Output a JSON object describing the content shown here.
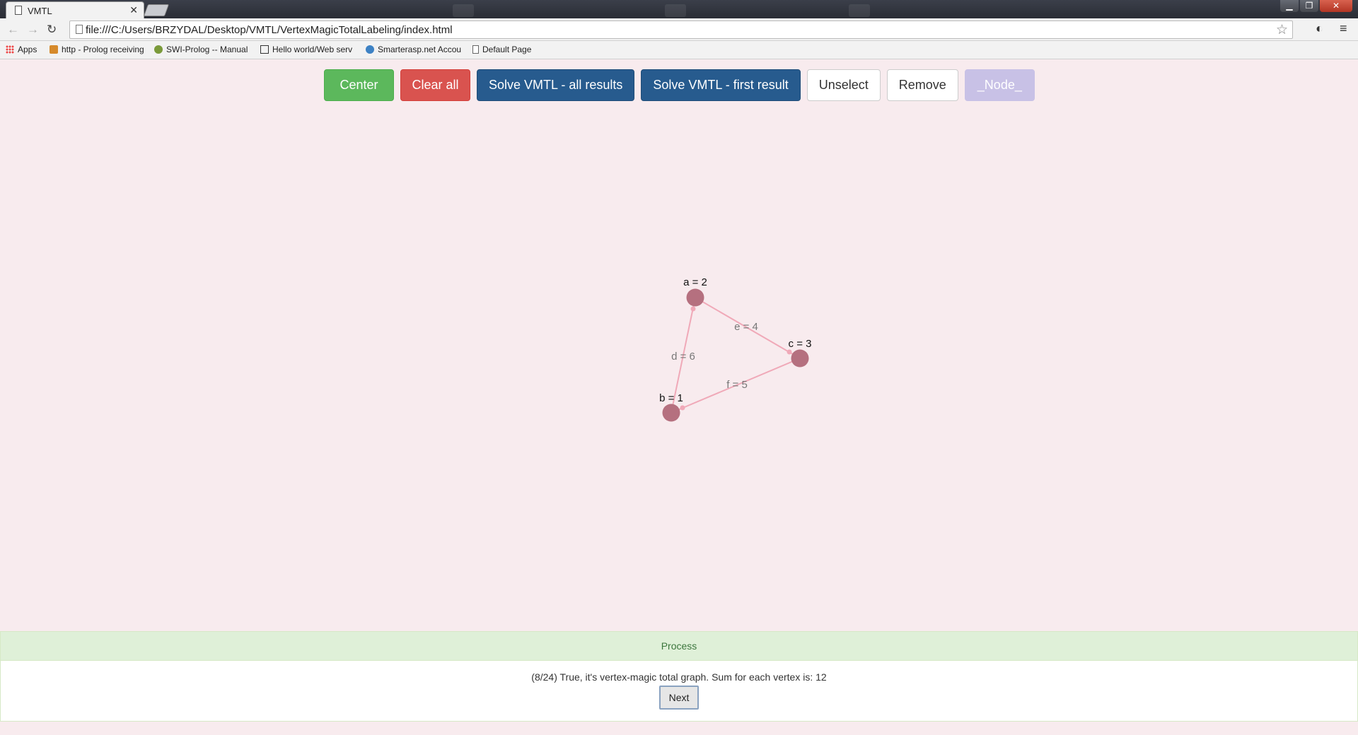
{
  "browser": {
    "tab_title": "VMTL",
    "tab_close": "✕",
    "window_controls": {
      "minimize": "▁",
      "maximize": "❐",
      "close": "✕"
    },
    "nav": {
      "back": "←",
      "forward": "→",
      "reload": "↻",
      "star": "☆",
      "extension": "◐",
      "menu": "≡"
    },
    "url": "file:///C:/Users/BRZYDAL/Desktop/VMTL/VertexMagicTotalLabeling/index.html",
    "bookmarks": [
      {
        "label": "Apps",
        "icon": "apps-grid-icon"
      },
      {
        "label": "http - Prolog receiving",
        "icon": "prolog-icon"
      },
      {
        "label": "SWI-Prolog -- Manual",
        "icon": "swi-prolog-icon"
      },
      {
        "label": "Hello world/Web serv",
        "icon": "rosetta-code-icon"
      },
      {
        "label": "Smarterasp.net Accou",
        "icon": "smarterasp-icon"
      },
      {
        "label": "Default Page",
        "icon": "page-icon"
      }
    ]
  },
  "toolbar": {
    "center": "Center",
    "clear_all": "Clear all",
    "solve_all": "Solve VMTL - all results",
    "solve_first": "Solve VMTL - first result",
    "unselect": "Unselect",
    "remove": "Remove",
    "node": "_Node_"
  },
  "graph": {
    "node_color": "#b5707f",
    "edge_color": "#f0a9b8",
    "nodes": [
      {
        "id": "a",
        "label": "a = 2",
        "value": 2
      },
      {
        "id": "b",
        "label": "b = 1",
        "value": 1
      },
      {
        "id": "c",
        "label": "c = 3",
        "value": 3
      }
    ],
    "edges": [
      {
        "id": "d",
        "from": "a",
        "to": "b",
        "label": "d = 6",
        "value": 6
      },
      {
        "id": "e",
        "from": "a",
        "to": "c",
        "label": "e = 4",
        "value": 4
      },
      {
        "id": "f",
        "from": "b",
        "to": "c",
        "label": "f = 5",
        "value": 5
      }
    ]
  },
  "process": {
    "heading": "Process",
    "message": "(8/24) True, it's vertex-magic total graph. Sum for each vertex is: 12",
    "next_label": "Next"
  }
}
